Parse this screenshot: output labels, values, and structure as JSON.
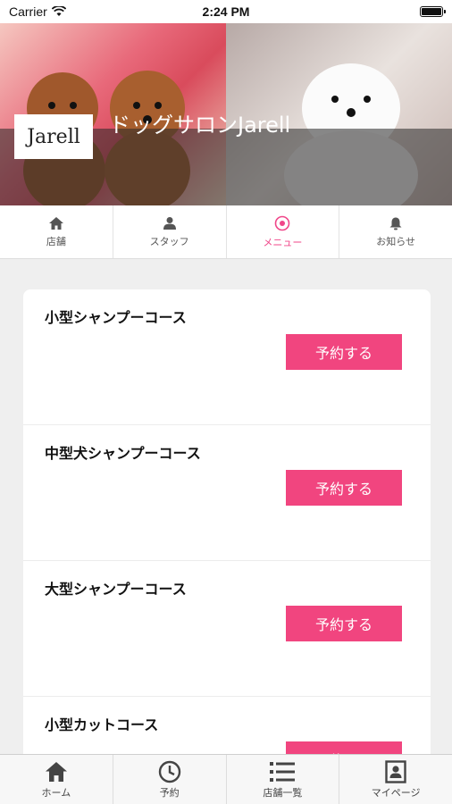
{
  "status_bar": {
    "carrier": "Carrier",
    "time": "2:24 PM"
  },
  "hero": {
    "logo_text": "Jarell",
    "salon_name": "ドッグサロンJarell"
  },
  "top_nav": {
    "items": [
      {
        "label": "店舗",
        "icon": "home-icon"
      },
      {
        "label": "スタッフ",
        "icon": "person-icon"
      },
      {
        "label": "メニュー",
        "icon": "target-icon",
        "active": true
      },
      {
        "label": "お知らせ",
        "icon": "bell-icon"
      }
    ],
    "active_color": "#f0478a"
  },
  "menu": {
    "reserve_label": "予約する",
    "items": [
      {
        "title": "小型シャンプーコース"
      },
      {
        "title": "中型犬シャンプーコース"
      },
      {
        "title": "大型シャンプーコース"
      },
      {
        "title": "小型カットコース"
      }
    ]
  },
  "tab_bar": {
    "items": [
      {
        "label": "ホーム",
        "icon": "home-icon"
      },
      {
        "label": "予約",
        "icon": "clock-icon"
      },
      {
        "label": "店舗一覧",
        "icon": "list-icon"
      },
      {
        "label": "マイページ",
        "icon": "profile-card-icon"
      }
    ]
  },
  "colors": {
    "accent": "#f1457f",
    "background": "#efefef"
  }
}
